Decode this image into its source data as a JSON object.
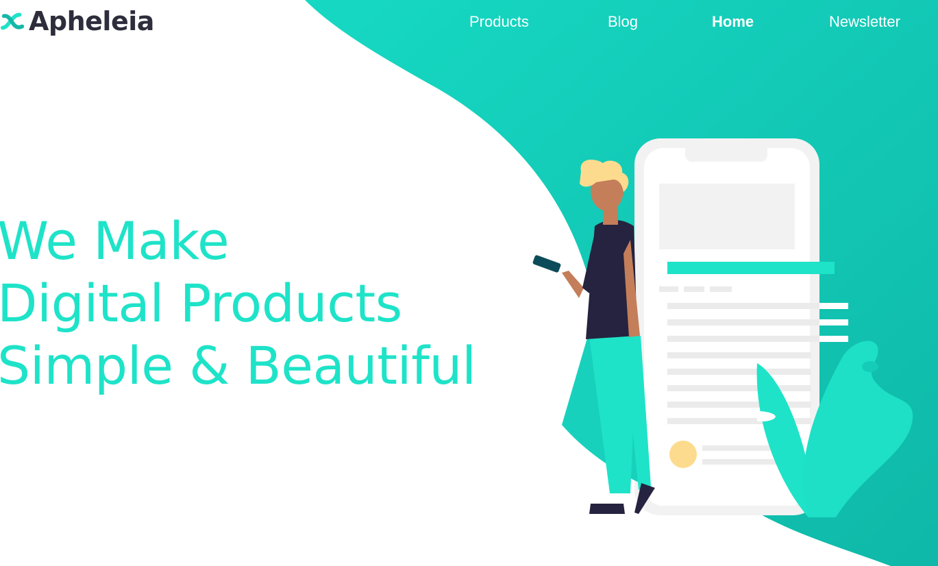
{
  "brand": {
    "name": "Apheleia",
    "logo_icon": "infinity-swirl-icon"
  },
  "nav": {
    "items": [
      {
        "label": "Products",
        "active": false
      },
      {
        "label": "Blog",
        "active": false
      },
      {
        "label": "Home",
        "active": true
      },
      {
        "label": "Newsletter",
        "active": false
      }
    ]
  },
  "hero": {
    "lines": [
      "We Make",
      "Digital Products",
      "Simple & Beautiful"
    ]
  },
  "illustration": {
    "icon": "person-with-phone-illustration"
  },
  "colors": {
    "accent": "#1ee3c8",
    "teal_bg": "#14ccb7",
    "logo_text": "#2e2d3c",
    "navy": "#25233f",
    "skin": "#c47e5a",
    "hair": "#fddb8e"
  }
}
